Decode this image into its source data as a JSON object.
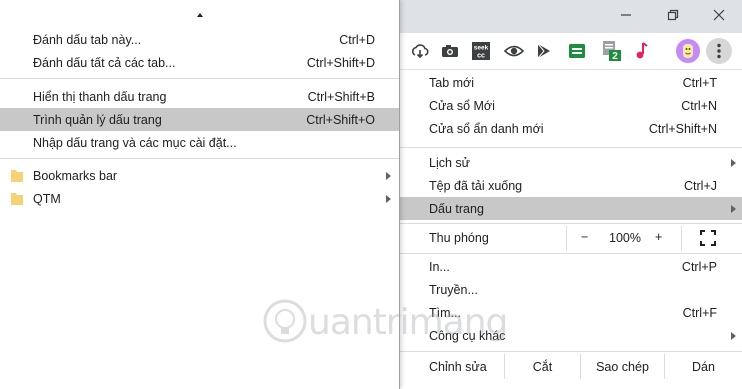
{
  "bookmarks_menu": {
    "items": [
      {
        "label": "Đánh dấu tab này...",
        "shortcut": "Ctrl+D"
      },
      {
        "label": "Đánh dấu tất cả các tab...",
        "shortcut": "Ctrl+Shift+D"
      },
      {
        "label": "Hiển thị thanh dấu trang",
        "shortcut": "Ctrl+Shift+B"
      },
      {
        "label": "Trình quản lý dấu trang",
        "shortcut": "Ctrl+Shift+O"
      },
      {
        "label": "Nhập dấu trang và các mục cài đặt...",
        "shortcut": ""
      }
    ],
    "folders": [
      {
        "label": "Bookmarks bar"
      },
      {
        "label": "QTM"
      }
    ],
    "highlighted": "Trình quản lý dấu trang"
  },
  "chrome_menu": {
    "items": [
      {
        "label": "Tab mới",
        "shortcut": "Ctrl+T"
      },
      {
        "label": "Cửa sổ Mới",
        "shortcut": "Ctrl+N"
      },
      {
        "label": "Cửa sổ ẩn danh mới",
        "shortcut": "Ctrl+Shift+N"
      },
      {
        "label": "Lịch sử",
        "shortcut": ""
      },
      {
        "label": "Tệp đã tải xuống",
        "shortcut": "Ctrl+J"
      },
      {
        "label": "Dấu trang",
        "shortcut": ""
      },
      {
        "label": "In...",
        "shortcut": "Ctrl+P"
      },
      {
        "label": "Truyền...",
        "shortcut": ""
      },
      {
        "label": "Tìm...",
        "shortcut": "Ctrl+F"
      },
      {
        "label": "Công cụ khác",
        "shortcut": ""
      }
    ],
    "zoom": {
      "label": "Thu phóng",
      "minus": "−",
      "value": "100%",
      "plus": "+"
    },
    "edit": {
      "label": "Chỉnh sửa",
      "cut": "Cắt",
      "copy": "Sao chép",
      "paste": "Dán"
    },
    "highlighted": "Dấu trang"
  },
  "toolbar": {
    "extensions": [
      "cloud-download-icon",
      "camera-icon",
      "seek-cc-icon",
      "eye-icon",
      "play-icon",
      "sheet-icon",
      "doc-badge-icon",
      "music-note-icon"
    ],
    "badge": "2",
    "seek_label": "seek",
    "cc_label": "cc"
  },
  "watermark": {
    "text": "uantrimang"
  },
  "colors": {
    "highlight": "#c8c8c8",
    "titlebar": "#dee1e6",
    "folder": "#f5d273"
  }
}
